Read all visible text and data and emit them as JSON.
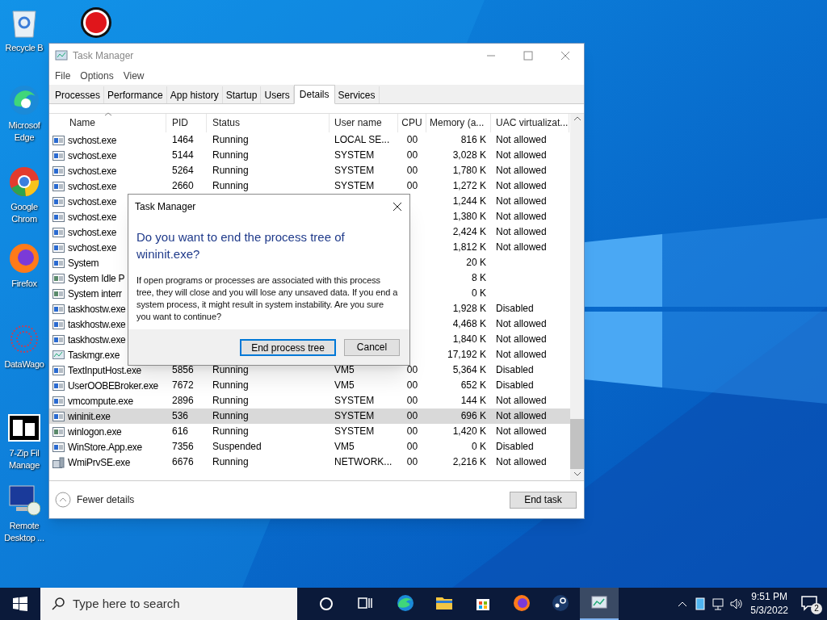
{
  "desktop_icons": [
    {
      "kind": "recycle",
      "label": "Recycle B"
    },
    {
      "kind": "record"
    },
    {
      "kind": "edge",
      "label": "Microsof Edge"
    },
    {
      "kind": "chrome",
      "label": "Google Chrom"
    },
    {
      "kind": "firefox",
      "label": "Firefox"
    },
    {
      "kind": "flower",
      "label": "DataWago"
    },
    {
      "kind": "zip",
      "label": "7-Zip Fil Manage"
    },
    {
      "kind": "remote",
      "label": "Remote Desktop ..."
    }
  ],
  "window": {
    "title": "Task Manager",
    "menu": [
      "File",
      "Options",
      "View"
    ],
    "tabs": [
      {
        "label": "Processes",
        "selected": false
      },
      {
        "label": "Performance",
        "selected": false
      },
      {
        "label": "App history",
        "selected": false
      },
      {
        "label": "Startup",
        "selected": false
      },
      {
        "label": "Users",
        "selected": false
      },
      {
        "label": "Details",
        "selected": true
      },
      {
        "label": "Services",
        "selected": false
      }
    ],
    "table": {
      "columns": [
        "Name",
        "PID",
        "Status",
        "User name",
        "CPU",
        "Memory (a...",
        "UAC virtualizat..."
      ],
      "rows": [
        {
          "kind": "service",
          "name": "svchost.exe",
          "pid": "1464",
          "status": "Running",
          "user": "LOCAL SE...",
          "cpu": "00",
          "memory": "816 K",
          "uac": "Not allowed",
          "selected": false
        },
        {
          "kind": "service",
          "name": "svchost.exe",
          "pid": "5144",
          "status": "Running",
          "user": "SYSTEM",
          "cpu": "00",
          "memory": "3,028 K",
          "uac": "Not allowed",
          "selected": false
        },
        {
          "kind": "service",
          "name": "svchost.exe",
          "pid": "5264",
          "status": "Running",
          "user": "SYSTEM",
          "cpu": "00",
          "memory": "1,780 K",
          "uac": "Not allowed",
          "selected": false
        },
        {
          "kind": "service",
          "name": "svchost.exe",
          "pid": "2660",
          "status": "Running",
          "user": "SYSTEM",
          "cpu": "00",
          "memory": "1,272 K",
          "uac": "Not allowed",
          "selected": false
        },
        {
          "kind": "service",
          "name": "svchost.exe",
          "memory": "1,244 K",
          "uac": "Not allowed",
          "selected": false
        },
        {
          "kind": "service",
          "name": "svchost.exe",
          "memory": "1,380 K",
          "uac": "Not allowed",
          "selected": false
        },
        {
          "kind": "service",
          "name": "svchost.exe",
          "memory": "2,424 K",
          "uac": "Not allowed",
          "selected": false
        },
        {
          "kind": "service",
          "name": "svchost.exe",
          "memory": "1,812 K",
          "uac": "Not allowed",
          "selected": false
        },
        {
          "kind": "service",
          "name": "System",
          "memory": "20 K",
          "selected": false
        },
        {
          "kind": "system",
          "name": "System Idle P",
          "memory": "8 K",
          "selected": false
        },
        {
          "kind": "system",
          "name": "System interr",
          "memory": "0 K",
          "selected": false
        },
        {
          "kind": "service",
          "name": "taskhostw.exe",
          "memory": "1,928 K",
          "uac": "Disabled",
          "selected": false
        },
        {
          "kind": "service",
          "name": "taskhostw.exe",
          "memory": "4,468 K",
          "uac": "Not allowed",
          "selected": false
        },
        {
          "kind": "service",
          "name": "taskhostw.exe",
          "memory": "1,840 K",
          "uac": "Not allowed",
          "selected": false
        },
        {
          "kind": "taskmgr",
          "name": "Taskmgr.exe",
          "memory": "17,192 K",
          "uac": "Not allowed",
          "selected": false
        },
        {
          "kind": "service",
          "name": "TextInputHost.exe",
          "pid": "5856",
          "status": "Running",
          "user": "VM5",
          "cpu": "00",
          "memory": "5,364 K",
          "uac": "Disabled",
          "selected": false
        },
        {
          "kind": "service",
          "name": "UserOOBEBroker.exe",
          "pid": "7672",
          "status": "Running",
          "user": "VM5",
          "cpu": "00",
          "memory": "652 K",
          "uac": "Disabled",
          "selected": false
        },
        {
          "kind": "service",
          "name": "vmcompute.exe",
          "pid": "2896",
          "status": "Running",
          "user": "SYSTEM",
          "cpu": "00",
          "memory": "144 K",
          "uac": "Not allowed",
          "selected": false
        },
        {
          "kind": "service",
          "name": "wininit.exe",
          "pid": "536",
          "status": "Running",
          "user": "SYSTEM",
          "cpu": "00",
          "memory": "696 K",
          "uac": "Not allowed",
          "selected": true
        },
        {
          "kind": "system",
          "name": "winlogon.exe",
          "pid": "616",
          "status": "Running",
          "user": "SYSTEM",
          "cpu": "00",
          "memory": "1,420 K",
          "uac": "Not allowed",
          "selected": false
        },
        {
          "kind": "service",
          "name": "WinStore.App.exe",
          "pid": "7356",
          "status": "Suspended",
          "user": "VM5",
          "cpu": "00",
          "memory": "0 K",
          "uac": "Disabled",
          "selected": false
        },
        {
          "kind": "wmi",
          "name": "WmiPrvSE.exe",
          "pid": "6676",
          "status": "Running",
          "user": "NETWORK...",
          "cpu": "00",
          "memory": "2,216 K",
          "uac": "Not allowed",
          "selected": false
        }
      ]
    },
    "fewer_details": "Fewer details",
    "end_task": "End task"
  },
  "dialog": {
    "title": "Task Manager",
    "heading": "Do you want to end the process tree of wininit.exe?",
    "message": "If open programs or processes are associated with this process tree, they will close and you will lose any unsaved data. If you end a system process, it might result in system instability. Are you sure you want to continue?",
    "buttons": [
      "End process tree",
      "Cancel"
    ]
  },
  "taskbar": {
    "search_placeholder": "Type here to search",
    "time": "9:51 PM",
    "date": "5/3/2022",
    "notifications": "2"
  }
}
